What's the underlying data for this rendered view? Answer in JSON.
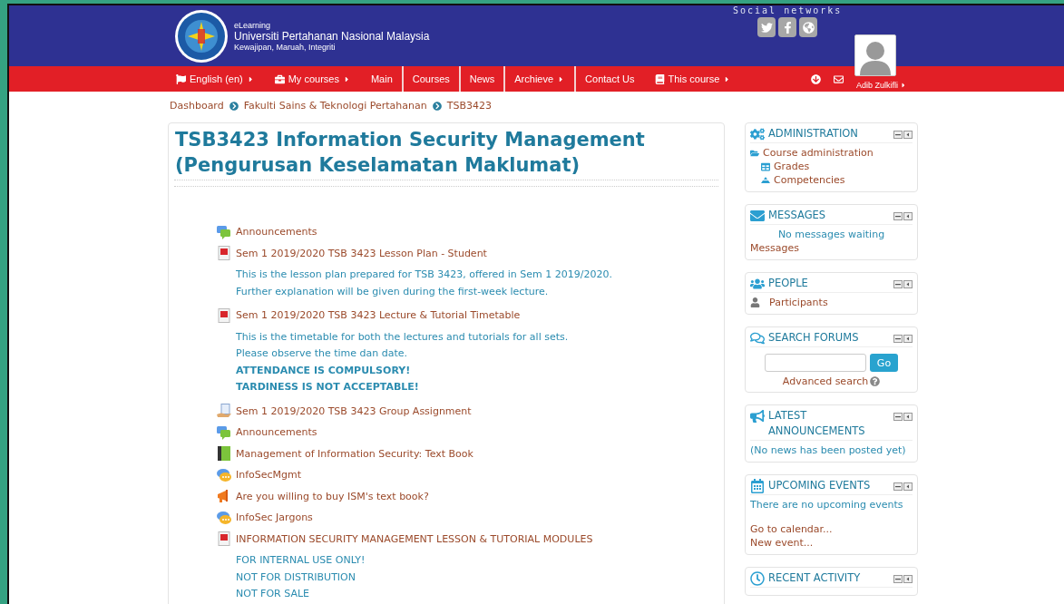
{
  "header": {
    "kicker": "eLearning",
    "title": "Universiti Pertahanan Nasional Malaysia",
    "motto": "Kewajipan, Maruah, Integriti",
    "social_label": "Social networks",
    "social": [
      {
        "kind": "twitter"
      },
      {
        "kind": "facebook"
      },
      {
        "kind": "globe"
      }
    ]
  },
  "nav": {
    "items": [
      {
        "kind": "language",
        "label": "English (en)",
        "caret": true,
        "separated": false
      },
      {
        "kind": "courses",
        "label": "My courses",
        "caret": true,
        "separated": false
      },
      {
        "kind": "link",
        "label": "Main",
        "caret": false,
        "separated": false
      },
      {
        "kind": "link",
        "label": "Courses",
        "caret": false,
        "separated": true
      },
      {
        "kind": "link",
        "label": "News",
        "caret": false,
        "separated": true
      },
      {
        "kind": "link",
        "label": "Archieve",
        "caret": true,
        "separated": true
      },
      {
        "kind": "link",
        "label": "Contact Us",
        "caret": false,
        "separated": true
      },
      {
        "kind": "course",
        "label": "This course",
        "caret": true,
        "separated": false
      }
    ],
    "user": {
      "name": "Adib Zulkifli"
    }
  },
  "breadcrumb": [
    "Dashboard",
    "Fakulti Sains & Teknologi Pertahanan",
    "TSB3423"
  ],
  "course_title": "TSB3423 Information Security Management (Pengurusan Keselamatan Maklumat)",
  "activities": [
    {
      "kind": "forum",
      "label": "Announcements"
    },
    {
      "kind": "pdf",
      "label": "Sem 1 2019/2020 TSB 3423 Lesson Plan - Student",
      "notes": [
        {
          "text": "This is the lesson plan prepared for TSB 3423, offered in Sem 1 2019/2020.",
          "bold": false
        },
        {
          "text": "Further explanation will be given during the first-week lecture.",
          "bold": false
        }
      ]
    },
    {
      "kind": "pdf",
      "label": "Sem 1 2019/2020 TSB 3423 Lecture & Tutorial Timetable",
      "notes": [
        {
          "text": "This is the timetable for both the lectures and tutorials for all sets.",
          "bold": false
        },
        {
          "text": "Please observe the time dan date.",
          "bold": false
        },
        {
          "text": "ATTENDANCE IS COMPULSORY!",
          "bold": true
        },
        {
          "text": "TARDINESS IS NOT ACCEPTABLE!",
          "bold": true
        }
      ]
    },
    {
      "kind": "assignment",
      "label": "Sem 1 2019/2020 TSB 3423 Group Assignment"
    },
    {
      "kind": "forum",
      "label": "Announcements"
    },
    {
      "kind": "book",
      "label": "Management of Information Security: Text Book"
    },
    {
      "kind": "chat",
      "label": "InfoSecMgmt"
    },
    {
      "kind": "feedback",
      "label": "Are you willing to buy ISM's text book?"
    },
    {
      "kind": "chat",
      "label": "InfoSec Jargons"
    },
    {
      "kind": "pdf",
      "label": "INFORMATION SECURITY MANAGEMENT LESSON & TUTORIAL MODULES",
      "notes": [
        {
          "text": "FOR INTERNAL USE ONLY!",
          "bold": false
        },
        {
          "text": "NOT FOR DISTRIBUTION",
          "bold": false
        },
        {
          "text": "NOT FOR SALE",
          "bold": false
        }
      ]
    }
  ],
  "blocks": [
    {
      "kind": "administration",
      "title": "ADMINISTRATION",
      "items": [
        {
          "kind": "category",
          "text": "Course administration",
          "children": [
            {
              "kind": "grades",
              "text": "Grades"
            },
            {
              "kind": "competencies",
              "text": "Competencies"
            }
          ]
        }
      ]
    },
    {
      "kind": "messages",
      "title": "MESSAGES",
      "items": [
        {
          "kind": "notice",
          "text": "No messages waiting"
        },
        {
          "kind": "link",
          "text": "Messages"
        }
      ]
    },
    {
      "kind": "people",
      "title": "PEOPLE",
      "items": [
        {
          "kind": "participants",
          "text": "Participants"
        }
      ]
    },
    {
      "kind": "search",
      "title": "SEARCH FORUMS",
      "button": "Go",
      "link": "Advanced search"
    },
    {
      "kind": "announcements",
      "title": "LATEST ANNOUNCEMENTS",
      "items": [
        {
          "kind": "info",
          "text": "(No news has been posted yet)"
        }
      ]
    },
    {
      "kind": "events",
      "title": "UPCOMING EVENTS",
      "items": [
        {
          "kind": "info",
          "text": "There are no upcoming events"
        },
        {
          "kind": "calendar",
          "text": "Go to calendar..."
        },
        {
          "kind": "new-event",
          "text": "New event..."
        }
      ]
    },
    {
      "kind": "activity",
      "title": "RECENT ACTIVITY"
    }
  ]
}
